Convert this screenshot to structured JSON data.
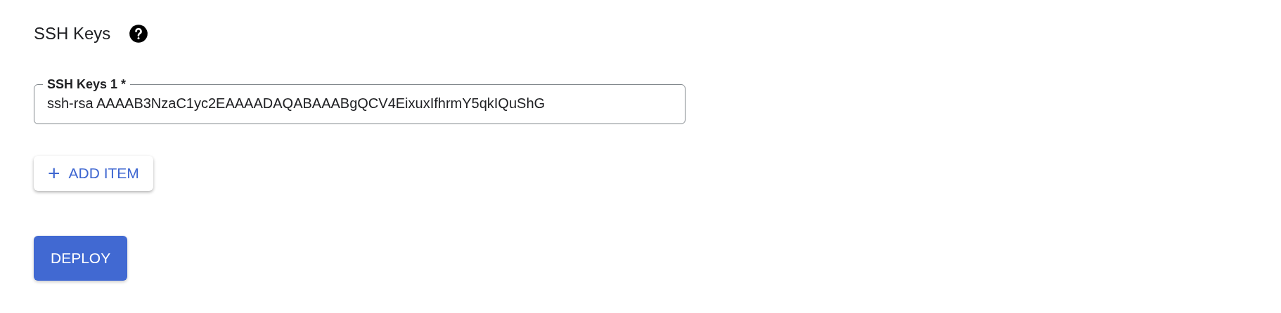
{
  "section": {
    "title": "SSH Keys"
  },
  "fields": [
    {
      "label": "SSH Keys 1 *",
      "value": "ssh-rsa AAAAB3NzaC1yc2EAAAADAQABAAABgQCV4EixuxIfhrmY5qkIQuShG"
    }
  ],
  "add_button": {
    "icon": "+",
    "label": "ADD ITEM"
  },
  "deploy_button": {
    "label": "DEPLOY"
  }
}
